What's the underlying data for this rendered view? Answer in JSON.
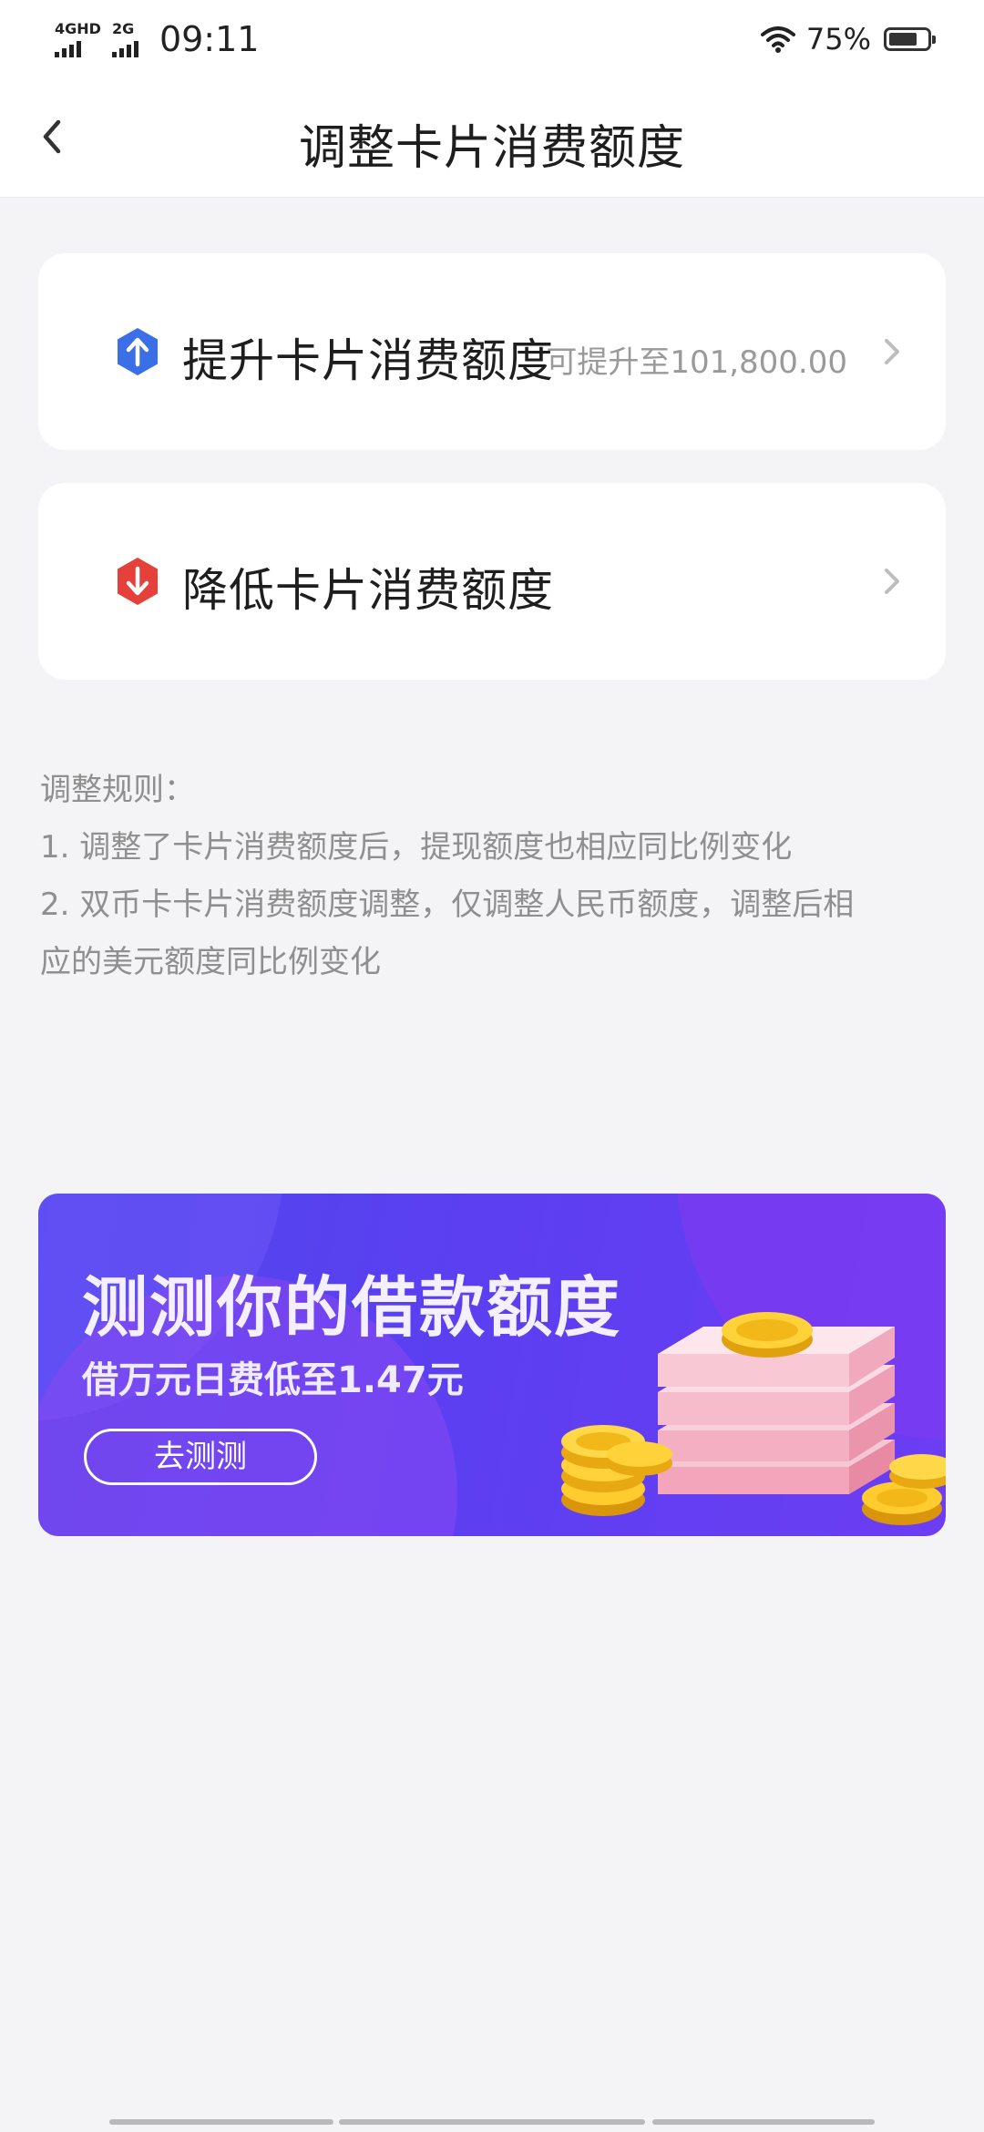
{
  "status_bar": {
    "network_1": "4GHD",
    "network_2": "2G",
    "time": "09:11",
    "battery_percent": "75%",
    "battery_level": 0.75
  },
  "header": {
    "title": "调整卡片消费额度",
    "back_icon": "chevron-left-icon"
  },
  "options": [
    {
      "icon": "arrow-up-hexagon-icon",
      "icon_color": "#3b6fe8",
      "label": "提升卡片消费额度",
      "hint": "可提升至101,800.00"
    },
    {
      "icon": "arrow-down-hexagon-icon",
      "icon_color": "#e5413a",
      "label": "降低卡片消费额度",
      "hint": ""
    }
  ],
  "rules": {
    "title": "调整规则：",
    "items": [
      "1. 调整了卡片消费额度后，提现额度也相应同比例变化",
      "2. 双币卡卡片消费额度调整，仅调整人民币额度，调整后相",
      "应的美元额度同比例变化"
    ]
  },
  "banner": {
    "title": "测测你的借款额度",
    "subtitle": "借万元日费低至1.47元",
    "button": "去测测",
    "art": "money-stack-coins-illustration",
    "background": "#5a42ef"
  }
}
